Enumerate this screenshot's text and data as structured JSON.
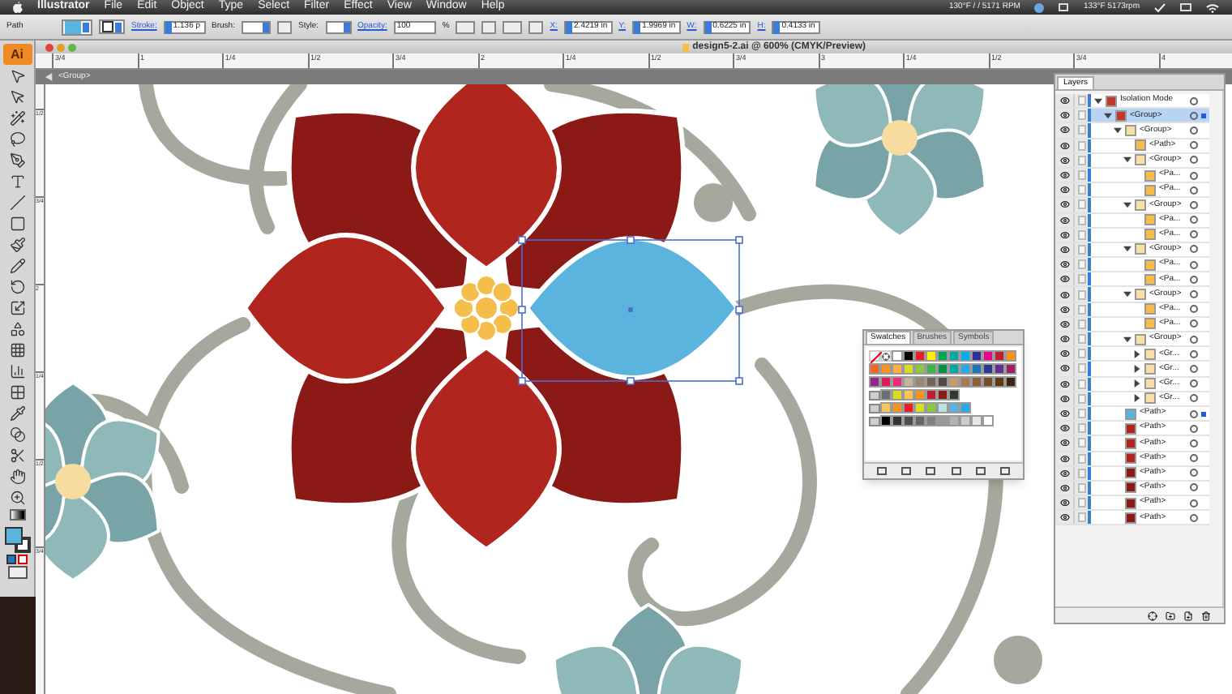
{
  "menu_bar": {
    "app": "Illustrator",
    "items": [
      "File",
      "Edit",
      "Object",
      "Type",
      "Select",
      "Filter",
      "Effect",
      "View",
      "Window",
      "Help"
    ],
    "status": [
      "130°F / / 5171 RPM",
      "133°F 5173rpm"
    ]
  },
  "control_bar": {
    "selection": "Path",
    "stroke_label": "Stroke:",
    "stroke_weight": "1.136 p",
    "brush_label": "Brush:",
    "style_label": "Style:",
    "opacity_label": "Opacity:",
    "opacity": "100",
    "percent": "%",
    "fields": [
      {
        "label": "X:",
        "value": "2.4219 in"
      },
      {
        "label": "Y:",
        "value": "1.9969 in"
      },
      {
        "label": "W:",
        "value": "0.6225 in"
      },
      {
        "label": "H:",
        "value": "0.4133 in"
      }
    ]
  },
  "toolbar": {
    "logo": "Ai"
  },
  "document": {
    "title": "design5-2.ai @ 600% (CMYK/Preview)",
    "ruler_labels": [
      "3/4",
      "1",
      "1/4",
      "1/2",
      "3/4",
      "2",
      "1/4",
      "1/2",
      "3/4",
      "3",
      "1/4",
      "1/2",
      "3/4",
      "4"
    ],
    "vertical_ruler_labels": [
      "1/2",
      "3/4",
      "2",
      "1/4",
      "1/2",
      "3/4"
    ],
    "isolation": "<Group>"
  },
  "swatches": {
    "tabs": [
      {
        "label": "Swatches",
        "selected": true
      },
      {
        "label": "Brushes",
        "selected": false
      },
      {
        "label": "Symbols",
        "selected": false
      }
    ],
    "rows": [
      {
        "folder": false,
        "items": [
          {
            "color": "#ffffff"
          },
          {
            "color": "#000000"
          },
          {
            "color": "#ed1c24"
          },
          {
            "color": "#fff200"
          },
          {
            "color": "#00a651"
          },
          {
            "color": "#00a99d"
          },
          {
            "color": "#00aeef"
          },
          {
            "color": "#2e3192"
          },
          {
            "color": "#ec008c"
          },
          {
            "color": "#be1e2d"
          },
          {
            "color": "#f7941d"
          }
        ]
      },
      {
        "folder": false,
        "items": [
          {
            "color": "#f26522"
          },
          {
            "color": "#f7941d"
          },
          {
            "color": "#fbb040"
          },
          {
            "color": "#d7df23"
          },
          {
            "color": "#8dc63f"
          },
          {
            "color": "#39b54a"
          },
          {
            "color": "#009444"
          },
          {
            "color": "#00a79d"
          },
          {
            "color": "#27aae1"
          },
          {
            "color": "#1c75bc"
          },
          {
            "color": "#2b3990"
          },
          {
            "color": "#662d91"
          },
          {
            "color": "#9e1f63"
          }
        ]
      },
      {
        "folder": false,
        "items": [
          {
            "color": "#92278f"
          },
          {
            "color": "#da1c5c"
          },
          {
            "color": "#ee2a7b"
          },
          {
            "color": "#c2b59b"
          },
          {
            "color": "#998675"
          },
          {
            "color": "#736357"
          },
          {
            "color": "#534741"
          },
          {
            "color": "#c69c6d"
          },
          {
            "color": "#a67c52"
          },
          {
            "color": "#8c6239"
          },
          {
            "color": "#754c24"
          },
          {
            "color": "#603913"
          },
          {
            "color": "#3c2415"
          }
        ]
      },
      {
        "folder": true,
        "items": [
          {
            "color": "#6d6e71"
          },
          {
            "color": "#d7df23"
          },
          {
            "color": "#f9c55a"
          },
          {
            "color": "#f7941d"
          },
          {
            "color": "#be1e2d"
          },
          {
            "color": "#8b1a16"
          },
          {
            "color": "#2f3d2f"
          }
        ]
      },
      {
        "folder": true,
        "items": [
          {
            "color": "#f9c55a"
          },
          {
            "color": "#f7941d"
          },
          {
            "color": "#ed1c24"
          },
          {
            "color": "#d7df23"
          },
          {
            "color": "#8dc63f"
          },
          {
            "color": "#b7e3e4"
          },
          {
            "color": "#5ab4de"
          },
          {
            "color": "#27aae1"
          }
        ]
      },
      {
        "folder": true,
        "items": [
          {
            "color": "#000000"
          },
          {
            "color": "#333333"
          },
          {
            "color": "#4d4d4d"
          },
          {
            "color": "#666666"
          },
          {
            "color": "#808080"
          },
          {
            "color": "#999999"
          },
          {
            "color": "#b3b3b3"
          },
          {
            "color": "#cccccc"
          },
          {
            "color": "#e6e6e6"
          },
          {
            "color": "#ffffff"
          }
        ]
      }
    ]
  },
  "layers": {
    "title": "Layers",
    "rows": [
      {
        "label": "Isolation Mode",
        "kind": "layer",
        "expanded": true,
        "selected": false,
        "current": false,
        "children": [
          {
            "label": "<Group>",
            "kind": "layer",
            "expanded": true,
            "selected": true,
            "current": true,
            "children": [
              {
                "label": "<Group>",
                "kind": "group",
                "expanded": true,
                "selected": false,
                "current": false,
                "children": [
                  {
                    "label": "<Path>",
                    "kind": "yellow",
                    "selected": false,
                    "current": false
                  },
                  {
                    "label": "<Group>",
                    "kind": "group",
                    "expanded": true,
                    "selected": false,
                    "current": false,
                    "children": [
                      {
                        "label": "<Pa...",
                        "kind": "yellow",
                        "selected": false,
                        "current": false
                      },
                      {
                        "label": "<Pa...",
                        "kind": "yellow",
                        "selected": false,
                        "current": false
                      }
                    ]
                  },
                  {
                    "label": "<Group>",
                    "kind": "group",
                    "expanded": true,
                    "selected": false,
                    "current": false,
                    "children": [
                      {
                        "label": "<Pa...",
                        "kind": "yellow",
                        "selected": false,
                        "current": false
                      },
                      {
                        "label": "<Pa...",
                        "kind": "yellow",
                        "selected": false,
                        "current": false
                      }
                    ]
                  },
                  {
                    "label": "<Group>",
                    "kind": "group",
                    "expanded": true,
                    "selected": false,
                    "current": false,
                    "children": [
                      {
                        "label": "<Pa...",
                        "kind": "yellow",
                        "selected": false,
                        "current": false
                      },
                      {
                        "label": "<Pa...",
                        "kind": "yellow",
                        "selected": false,
                        "current": false
                      }
                    ]
                  },
                  {
                    "label": "<Group>",
                    "kind": "group",
                    "expanded": true,
                    "selected": false,
                    "current": false,
                    "children": [
                      {
                        "label": "<Pa...",
                        "kind": "yellow",
                        "selected": false,
                        "current": false
                      },
                      {
                        "label": "<Pa...",
                        "kind": "yellow",
                        "selected": false,
                        "current": false
                      }
                    ]
                  },
                  {
                    "label": "<Group>",
                    "kind": "group",
                    "expanded": true,
                    "selected": false,
                    "current": false,
                    "children": [
                      {
                        "label": "<Gr...",
                        "kind": "group",
                        "expanded": false,
                        "selected": false,
                        "current": false
                      },
                      {
                        "label": "<Gr...",
                        "kind": "group",
                        "expanded": false,
                        "selected": false,
                        "current": false
                      },
                      {
                        "label": "<Gr...",
                        "kind": "group",
                        "expanded": false,
                        "selected": false,
                        "current": false
                      },
                      {
                        "label": "<Gr...",
                        "kind": "group",
                        "expanded": false,
                        "selected": false,
                        "current": false
                      }
                    ]
                  }
                ]
              },
              {
                "label": "<Path>",
                "kind": "blue",
                "selected": true,
                "current": false
              },
              {
                "label": "<Path>",
                "kind": "red",
                "selected": false,
                "current": false
              },
              {
                "label": "<Path>",
                "kind": "red",
                "selected": false,
                "current": false
              },
              {
                "label": "<Path>",
                "kind": "red",
                "selected": false,
                "current": false
              },
              {
                "label": "<Path>",
                "kind": "darkred",
                "selected": false,
                "current": false
              },
              {
                "label": "<Path>",
                "kind": "darkred",
                "selected": false,
                "current": false
              },
              {
                "label": "<Path>",
                "kind": "darkred",
                "selected": false,
                "current": false
              },
              {
                "label": "<Path>",
                "kind": "darkred",
                "selected": false,
                "current": false
              }
            ]
          }
        ]
      }
    ]
  }
}
